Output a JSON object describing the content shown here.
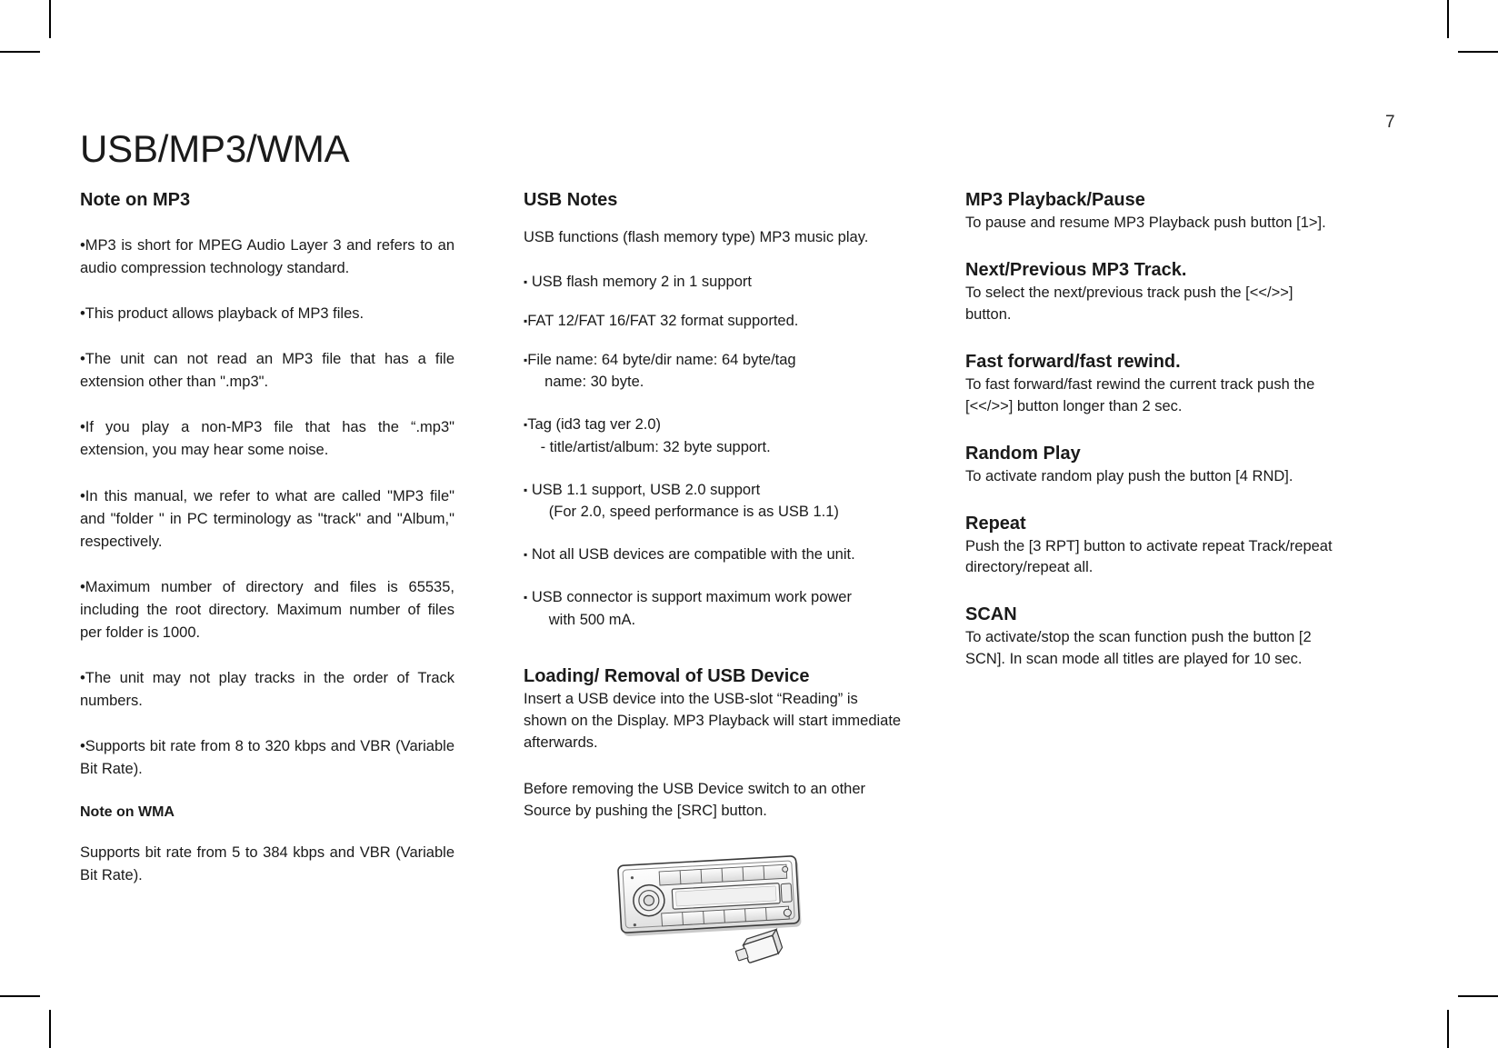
{
  "page": {
    "number": "7",
    "title": "USB/MP3/WMA"
  },
  "left_column": {
    "heading": "Note on MP3",
    "bullets": [
      "•MP3 is short for MPEG Audio Layer 3 and refers to an audio compression technology standard.",
      "•This product allows playback of MP3 files.",
      "•The unit can not read an MP3 file that has a file extension other than \".mp3\".",
      "•If you play a non-MP3 file that has the “.mp3\" extension, you may hear some noise.",
      "•In this manual, we refer to what are called \"MP3 file\" and \"folder \" in PC terminology as \"track\" and \"Album,\" respectively.",
      "•Maximum number of directory and files is 65535, including the root directory. Maximum number of files per folder is 1000.",
      "•The unit may not play tracks in the order of Track numbers.",
      "•Supports bit rate from 8 to 320 kbps and VBR (Variable Bit Rate)."
    ],
    "wma_heading": "Note on WMA",
    "wma_text": "Supports bit rate from 5 to 384 kbps and VBR (Variable Bit Rate)."
  },
  "middle_column": {
    "heading": "USB Notes",
    "intro": "USB functions (flash memory type) MP3 music play.",
    "bullets": [
      {
        "marker": "▪",
        "space": " ",
        "text": "USB flash memory 2 in 1 support"
      },
      {
        "marker": "▪",
        "space": "",
        "text": "FAT 12/FAT 16/FAT 32 format supported."
      },
      {
        "marker": "▪",
        "space": "",
        "text": "File name: 64 byte/dir name: 64 byte/tag\n  name: 30 byte."
      },
      {
        "marker": "▪",
        "space": "",
        "text": "Tag (id3 tag ver 2.0)\n - title/artist/album: 32 byte support."
      },
      {
        "marker": "▪",
        "space": " ",
        "text": "USB 1.1 support, USB 2.0 support\n   (For 2.0, speed performance is as USB 1.1)"
      },
      {
        "marker": "▪",
        "space": " ",
        "text": "Not all USB devices are compatible with the unit."
      },
      {
        "marker": "▪",
        "space": " ",
        "text": "USB connector is support maximum work power\n   with 500 mA."
      }
    ],
    "loading_heading": "Loading/ Removal of USB Device",
    "loading_text": "Insert a USB device into the USB-slot “Reading” is shown on the Display. MP3 Playback will start immediate afterwards.",
    "removal_text": "Before removing the USB Device switch to an other Source by pushing the [SRC] button.",
    "illustration_name": "car-stereo-faceplate-with-usb-drive"
  },
  "right_column": {
    "sections": [
      {
        "heading": "MP3 Playback/Pause",
        "body": "To pause and resume MP3 Playback push button [1>]."
      },
      {
        "heading": "Next/Previous MP3 Track.",
        "body": "To select the next/previous track push the [<</>>] button."
      },
      {
        "heading": "Fast forward/fast rewind.",
        "body": "To fast forward/fast rewind the current track push the [<</>>] button longer than 2 sec."
      },
      {
        "heading": "Random Play",
        "body": "To activate random play push the button [4 RND]."
      },
      {
        "heading": "Repeat",
        "body": "Push the [3 RPT] button to activate repeat Track/repeat directory/repeat all."
      },
      {
        "heading": "SCAN",
        "body": "To activate/stop the scan function push the button [2 SCN]. In scan mode all titles are played for 10 sec."
      }
    ]
  },
  "colors": {
    "text": "#1a1a1a",
    "page_background": "#ffffff",
    "crop_mark": "#000000"
  }
}
